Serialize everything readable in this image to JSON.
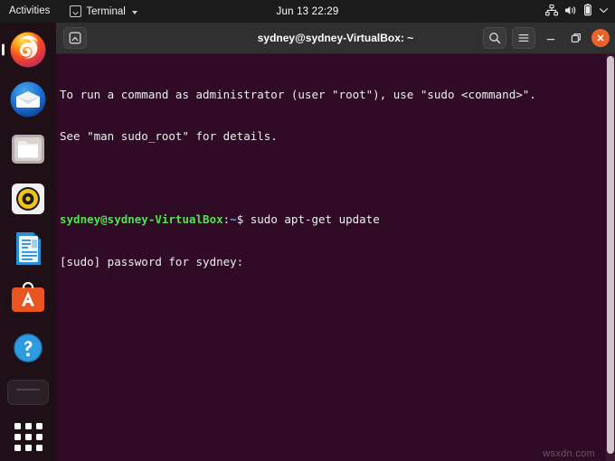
{
  "topbar": {
    "activities_label": "Activities",
    "app_name": "Terminal",
    "app_icon": "terminal-icon",
    "app_chevron_icon": "chevron-down-icon",
    "clock": "Jun 13  22:29",
    "tray": [
      {
        "name": "network-icon",
        "label": "network"
      },
      {
        "name": "volume-icon",
        "label": "volume"
      },
      {
        "name": "battery-icon",
        "label": "battery"
      },
      {
        "name": "system-menu-chevron-icon",
        "label": "system menu"
      }
    ]
  },
  "dock": {
    "items": [
      {
        "name": "dock-item-firefox",
        "label": "Firefox",
        "icon": "firefox-icon"
      },
      {
        "name": "dock-item-thunderbird",
        "label": "Thunderbird Mail",
        "icon": "thunderbird-icon"
      },
      {
        "name": "dock-item-files",
        "label": "Files",
        "icon": "files-folder-icon"
      },
      {
        "name": "dock-item-rhythmbox",
        "label": "Rhythmbox",
        "icon": "rhythmbox-icon"
      },
      {
        "name": "dock-item-libreoffice-writer",
        "label": "LibreOffice Writer",
        "icon": "libreoffice-writer-icon"
      },
      {
        "name": "dock-item-ubuntu-software",
        "label": "Ubuntu Software",
        "icon": "ubuntu-software-icon"
      },
      {
        "name": "dock-item-help",
        "label": "Help",
        "icon": "help-question-icon"
      },
      {
        "name": "dock-item-trash",
        "label": "Trash",
        "icon": "trash-icon"
      }
    ],
    "app_grid": {
      "name": "show-applications",
      "label": "Show Applications",
      "icon": "app-grid-icon"
    }
  },
  "window": {
    "title": "sydney@sydney-VirtualBox: ~",
    "new_tab_icon": "new-terminal-icon",
    "search_icon": "search-icon",
    "menu_icon": "hamburger-menu-icon",
    "minimize_icon": "minimize-icon",
    "maximize_icon": "maximize-icon",
    "close_icon": "close-icon"
  },
  "terminal": {
    "lines": [
      {
        "type": "plain",
        "text": "To run a command as administrator (user \"root\"), use \"sudo <command>\"."
      },
      {
        "type": "plain",
        "text": "See \"man sudo_root\" for details."
      },
      {
        "type": "blank",
        "text": ""
      },
      {
        "type": "prompt",
        "user": "sydney@sydney-VirtualBox",
        "sep": ":",
        "path": "~",
        "rest": "$ sudo apt-get update"
      },
      {
        "type": "plain",
        "text": "[sudo] password for sydney:"
      }
    ]
  },
  "watermark": {
    "text": "wsxdn.com"
  },
  "colors": {
    "topbar_bg": "#1b1b1b",
    "dock_bg": "#1f1018",
    "terminal_bg": "#300b26",
    "titlebar_bg": "#303030",
    "close_button": "#e8622c",
    "prompt_user": "#4ee44e",
    "prompt_path": "#6aa6e8",
    "terminal_text": "#eeeeee"
  }
}
